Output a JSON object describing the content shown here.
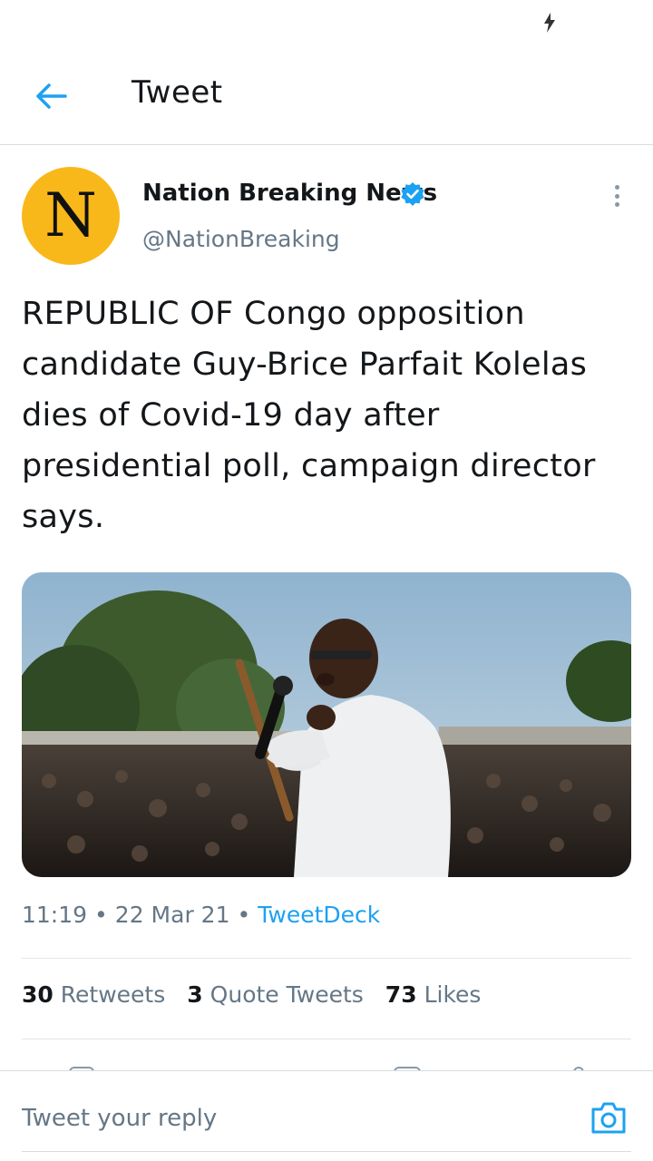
{
  "header": {
    "title": "Tweet"
  },
  "tweet": {
    "author": {
      "avatar_letter": "N",
      "name": "Nation Breaking News",
      "handle": "@NationBreaking",
      "verified": true
    },
    "text": "REPUBLIC OF Congo opposition candidate Guy-Brice Parfait Kolelas dies of Covid-19 day after presidential poll, campaign director says.",
    "media": {
      "description_icon": "photo"
    },
    "meta": {
      "time": "11:19",
      "date": "22 Mar 21",
      "separator": "•",
      "source": "TweetDeck"
    },
    "stats": {
      "retweets_count": "30",
      "retweets_label": "Retweets",
      "quotes_count": "3",
      "quotes_label": "Quote Tweets",
      "likes_count": "73",
      "likes_label": "Likes"
    }
  },
  "reply": {
    "placeholder": "Tweet your reply"
  },
  "colors": {
    "accent": "#1da1f2",
    "avatar_bg": "#f9b81a",
    "secondary_text": "#657786"
  },
  "icons": {
    "back": "arrow-left-icon",
    "verified": "verified-badge-icon",
    "more": "more-vertical-icon",
    "camera": "camera-icon",
    "status": "charging-bolt-icon"
  }
}
